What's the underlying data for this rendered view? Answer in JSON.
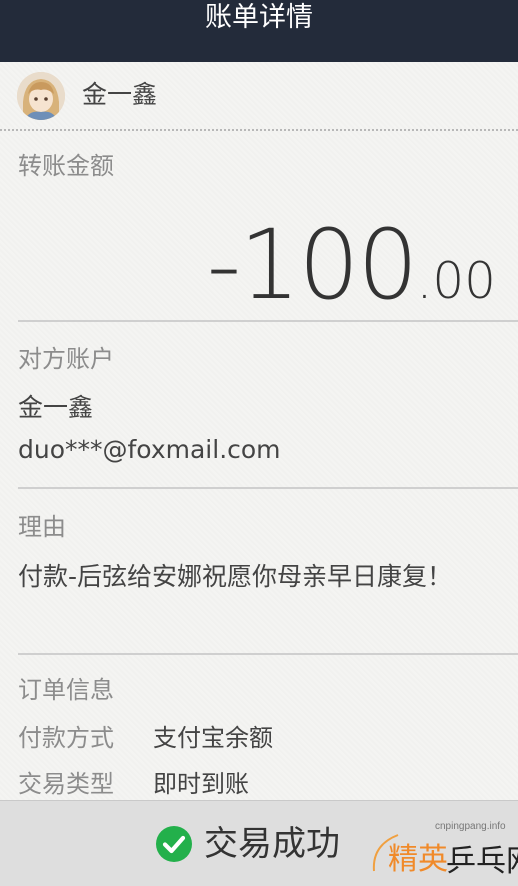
{
  "header": {
    "title": "账单详情"
  },
  "user": {
    "name": "金一鑫",
    "avatar": "avatar"
  },
  "amount": {
    "label": "转账金额",
    "main": "-100",
    "cents": ".00"
  },
  "counterparty": {
    "label": "对方账户",
    "name": "金一鑫",
    "account": "duo***@foxmail.com"
  },
  "reason": {
    "label": "理由",
    "text": "付款-后弦给安娜祝愿你母亲早日康复！"
  },
  "order": {
    "label": "订单信息",
    "rows": [
      {
        "key": "付款方式",
        "value": "支付宝余额"
      },
      {
        "key": "交易类型",
        "value": "即时到账"
      }
    ]
  },
  "footer": {
    "status_text": "交易成功",
    "status_icon": "check-circle-icon",
    "status_color": "#23b04b"
  },
  "watermark": {
    "site": "cnpingpang.info",
    "logo_text": "精英乒乓网"
  }
}
